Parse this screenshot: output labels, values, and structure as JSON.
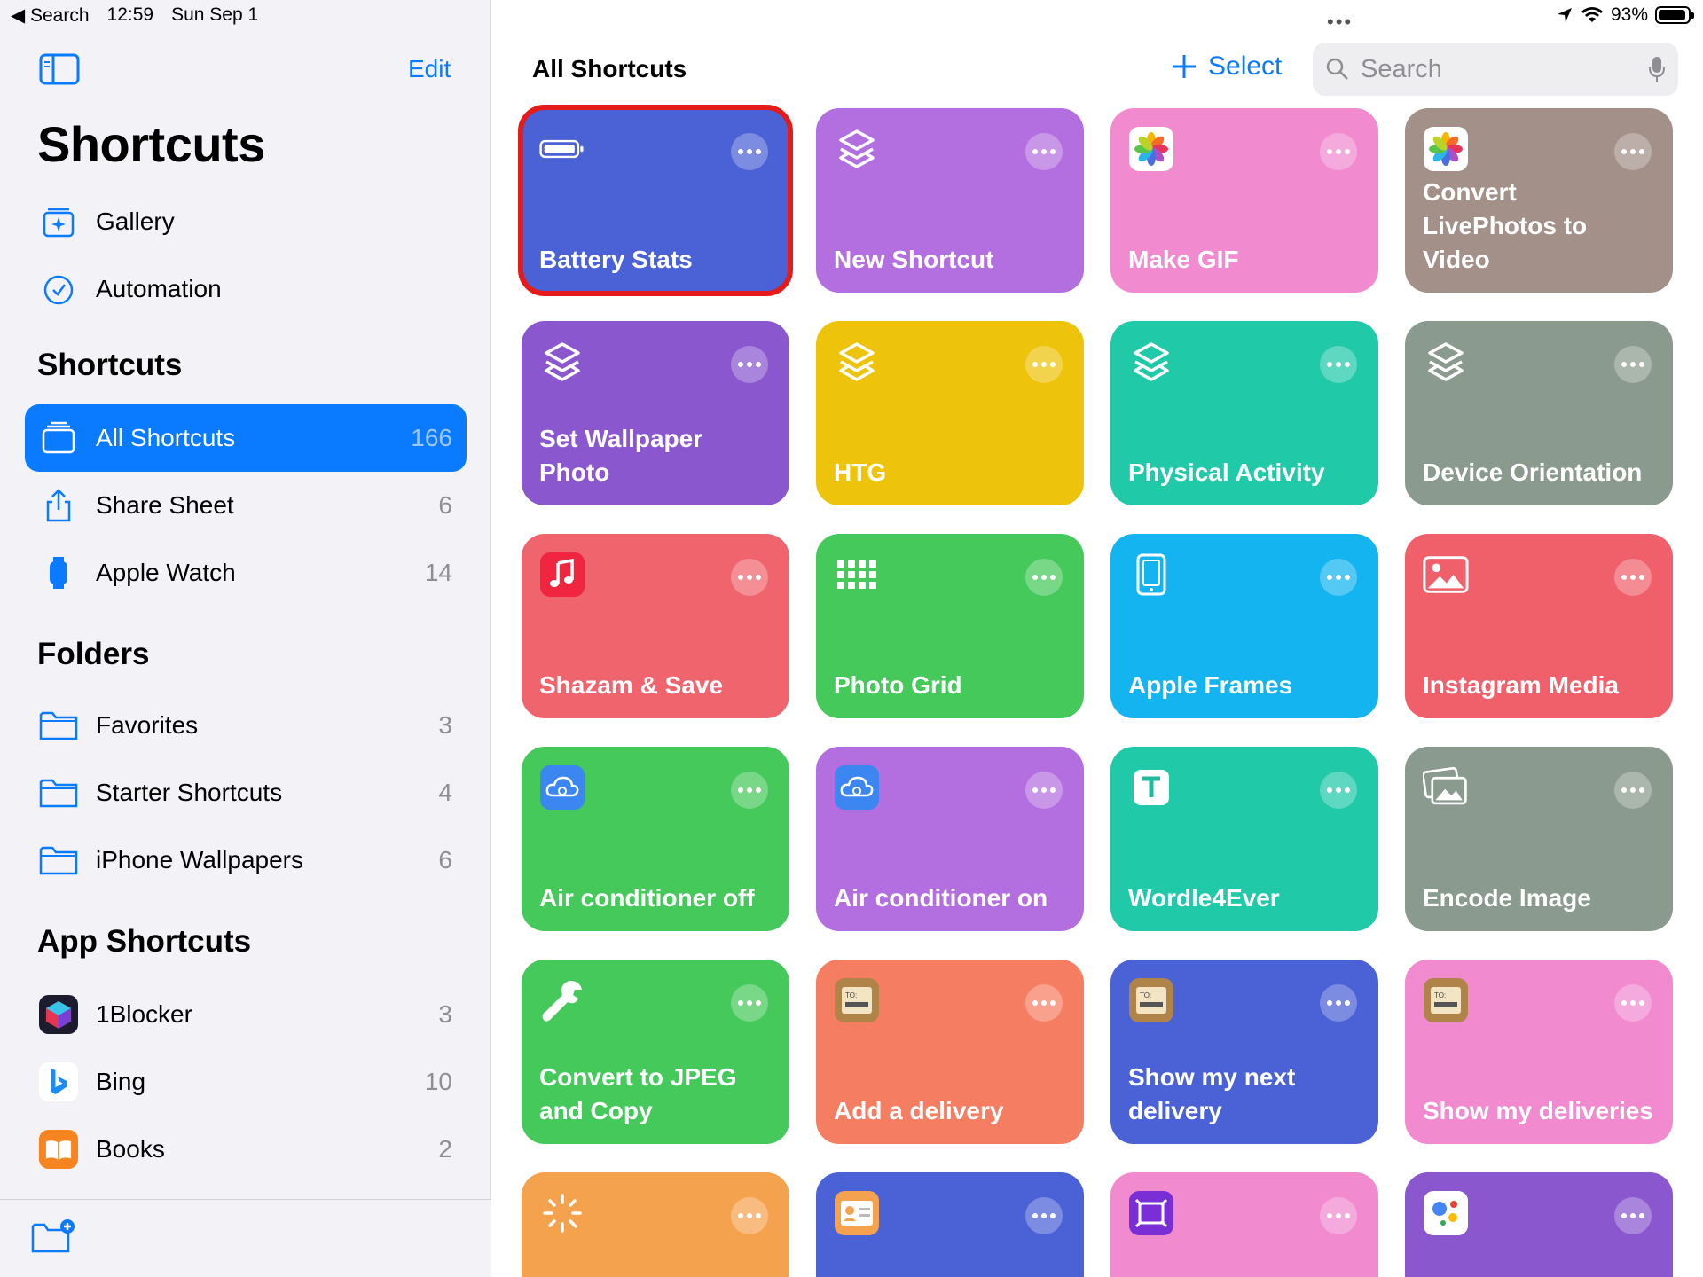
{
  "status_bar": {
    "back_label": "◀ Search",
    "time": "12:59",
    "date": "Sun Sep 1",
    "battery": "93%"
  },
  "sidebar": {
    "edit_label": "Edit",
    "title": "Shortcuts",
    "top_items": [
      {
        "label": "Gallery"
      },
      {
        "label": "Automation"
      }
    ],
    "shortcuts_header": "Shortcuts",
    "shortcuts_items": [
      {
        "label": "All Shortcuts",
        "count": "166"
      },
      {
        "label": "Share Sheet",
        "count": "6"
      },
      {
        "label": "Apple Watch",
        "count": "14"
      }
    ],
    "folders_header": "Folders",
    "folders": [
      {
        "label": "Favorites",
        "count": "3"
      },
      {
        "label": "Starter Shortcuts",
        "count": "4"
      },
      {
        "label": "iPhone Wallpapers",
        "count": "6"
      }
    ],
    "app_shortcuts_header": "App Shortcuts",
    "app_shortcuts": [
      {
        "label": "1Blocker",
        "count": "3"
      },
      {
        "label": "Bing",
        "count": "10"
      },
      {
        "label": "Books",
        "count": "2"
      }
    ]
  },
  "main": {
    "title": "All Shortcuts",
    "select_label": "Select",
    "search_placeholder": "Search",
    "tiles": [
      {
        "name": "Battery Stats",
        "color": "#4a62d6",
        "icon": "battery-icon"
      },
      {
        "name": "New Shortcut",
        "color": "#b36fe0",
        "icon": "shortcuts-layers-icon"
      },
      {
        "name": "Make GIF",
        "color": "#f28ad0",
        "icon": "photos-app-icon"
      },
      {
        "name": "Convert LivePhotos to Video",
        "color": "#a39088",
        "icon": "photos-app-icon"
      },
      {
        "name": "Set Wallpaper Photo",
        "color": "#8a57cf",
        "icon": "shortcuts-layers-icon"
      },
      {
        "name": "HTG",
        "color": "#edc30b",
        "icon": "shortcuts-layers-icon"
      },
      {
        "name": "Physical Activity",
        "color": "#20c9a8",
        "icon": "shortcuts-layers-icon"
      },
      {
        "name": "Device Orientation",
        "color": "#8b9a8e",
        "icon": "shortcuts-layers-icon"
      },
      {
        "name": "Shazam & Save",
        "color": "#f0646d",
        "icon": "music-note-icon"
      },
      {
        "name": "Photo Grid",
        "color": "#45c95b",
        "icon": "grid-dots-icon"
      },
      {
        "name": "Apple Frames",
        "color": "#13b4f0",
        "icon": "phone-frame-icon"
      },
      {
        "name": "Instagram Media",
        "color": "#f0606b",
        "icon": "image-icon"
      },
      {
        "name": "Air conditioner off",
        "color": "#45c95b",
        "icon": "cloud-icon"
      },
      {
        "name": "Air conditioner on",
        "color": "#b36fe0",
        "icon": "cloud-icon"
      },
      {
        "name": "Wordle4Ever",
        "color": "#20c9a8",
        "icon": "text-t-icon"
      },
      {
        "name": "Encode Image",
        "color": "#8b9a8e",
        "icon": "photos-stack-icon"
      },
      {
        "name": "Convert to JPEG and Copy",
        "color": "#45c95b",
        "icon": "wrench-icon"
      },
      {
        "name": "Add a delivery",
        "color": "#f57d62",
        "icon": "parcel-icon"
      },
      {
        "name": "Show my next delivery",
        "color": "#4a62d6",
        "icon": "parcel-icon"
      },
      {
        "name": "Show my deliveries",
        "color": "#f28ad0",
        "icon": "parcel-icon"
      },
      {
        "name": "",
        "color": "#f5a24f",
        "icon": "sparkle-wand-icon"
      },
      {
        "name": "",
        "color": "#4a62d6",
        "icon": "contact-card-icon"
      },
      {
        "name": "",
        "color": "#f28ad0",
        "icon": "frame-app-icon"
      },
      {
        "name": "",
        "color": "#8a57cf",
        "icon": "google-assistant-icon"
      }
    ]
  }
}
